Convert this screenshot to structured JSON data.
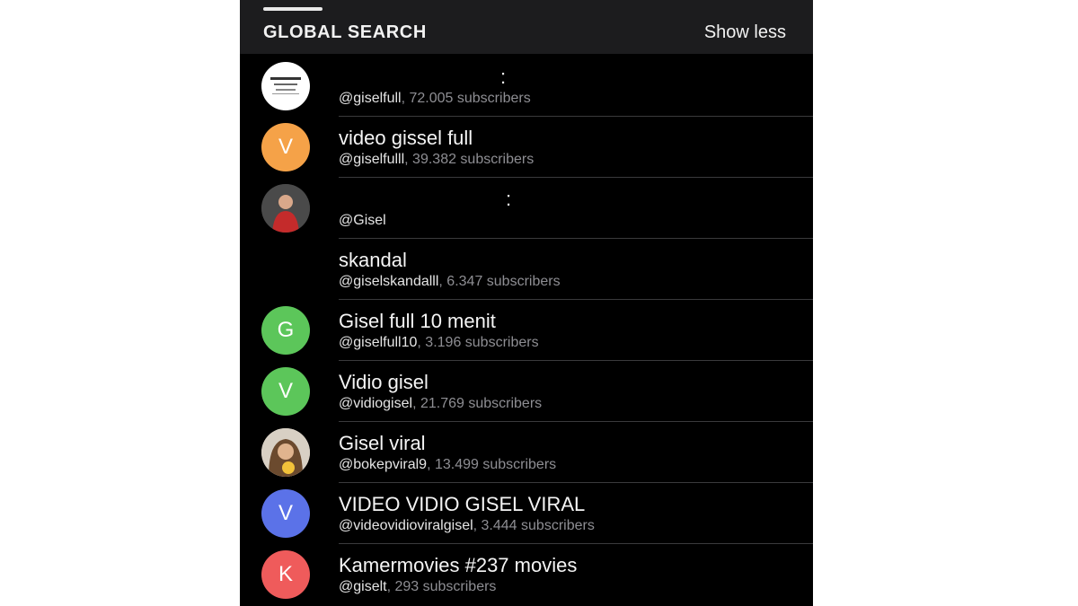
{
  "header": {
    "title": "GLOBAL SEARCH",
    "action": "Show less"
  },
  "results": [
    {
      "name": "",
      "handle": "@giselfull",
      "subscribers": ", 72.005 subscribers",
      "avatar_letter": "",
      "avatar_color": "#ffffff",
      "avatar_kind": "logo-image"
    },
    {
      "name": "video gissel full",
      "handle": "@giselfulll",
      "subscribers": ", 39.382 subscribers",
      "avatar_letter": "V",
      "avatar_color": "#f5a248"
    },
    {
      "name": "",
      "handle": "@Gisel",
      "subscribers": "",
      "avatar_letter": "",
      "avatar_color": "#b33a3a",
      "avatar_kind": "photo-image"
    },
    {
      "name": "skandal",
      "handle": "@giselskandalll",
      "subscribers": ", 6.347 subscribers",
      "avatar_letter": "",
      "avatar_color": "#000000"
    },
    {
      "name": "Gisel full 10 menit",
      "handle": "@giselfull10",
      "subscribers": ", 3.196 subscribers",
      "avatar_letter": "G",
      "avatar_color": "#5cc65a"
    },
    {
      "name": "Vidio gisel",
      "handle": "@vidiogisel",
      "subscribers": ", 21.769 subscribers",
      "avatar_letter": "V",
      "avatar_color": "#5cc65a"
    },
    {
      "name": "Gisel viral",
      "handle": "@bokepviral9",
      "subscribers": ", 13.499 subscribers",
      "avatar_letter": "",
      "avatar_color": "#c9a47a",
      "avatar_kind": "photo-image"
    },
    {
      "name": "VIDEO VIDIO GISEL VIRAL",
      "handle": "@videovidioviralgisel",
      "subscribers": ", 3.444 subscribers",
      "avatar_letter": "V",
      "avatar_color": "#5b72e8"
    },
    {
      "name": "Kamermovies #237 movies",
      "handle": "@giselt",
      "subscribers": ", 293 subscribers",
      "avatar_letter": "K",
      "avatar_color": "#ef5b5b"
    }
  ]
}
